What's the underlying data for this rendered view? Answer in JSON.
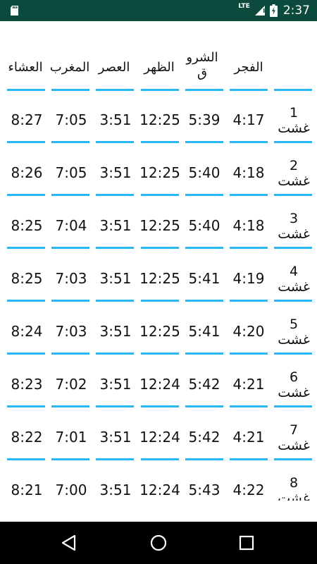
{
  "status_bar": {
    "network": "LTE",
    "time": "2:37",
    "icons": [
      "sd-card-icon",
      "signal-icon",
      "battery-charging-icon"
    ]
  },
  "table": {
    "headers": [
      "العشاء",
      "المغرب",
      "العصر",
      "الظهر",
      "الشروق",
      "الفجر",
      ""
    ],
    "rows": [
      {
        "day": "1",
        "month": "غشت",
        "isha": "8:27",
        "maghrib": "7:05",
        "asr": "3:51",
        "dhuhr": "12:25",
        "sunrise": "5:39",
        "fajr": "4:17"
      },
      {
        "day": "2",
        "month": "غشت",
        "isha": "8:26",
        "maghrib": "7:05",
        "asr": "3:51",
        "dhuhr": "12:25",
        "sunrise": "5:40",
        "fajr": "4:18"
      },
      {
        "day": "3",
        "month": "غشت",
        "isha": "8:25",
        "maghrib": "7:04",
        "asr": "3:51",
        "dhuhr": "12:25",
        "sunrise": "5:40",
        "fajr": "4:18"
      },
      {
        "day": "4",
        "month": "غشت",
        "isha": "8:25",
        "maghrib": "7:03",
        "asr": "3:51",
        "dhuhr": "12:25",
        "sunrise": "5:41",
        "fajr": "4:19"
      },
      {
        "day": "5",
        "month": "غشت",
        "isha": "8:24",
        "maghrib": "7:03",
        "asr": "3:51",
        "dhuhr": "12:25",
        "sunrise": "5:41",
        "fajr": "4:20"
      },
      {
        "day": "6",
        "month": "غشت",
        "isha": "8:23",
        "maghrib": "7:02",
        "asr": "3:51",
        "dhuhr": "12:24",
        "sunrise": "5:42",
        "fajr": "4:21"
      },
      {
        "day": "7",
        "month": "غشت",
        "isha": "8:22",
        "maghrib": "7:01",
        "asr": "3:51",
        "dhuhr": "12:24",
        "sunrise": "5:42",
        "fajr": "4:21"
      },
      {
        "day": "8",
        "month": "غشت",
        "isha": "8:21",
        "maghrib": "7:00",
        "asr": "3:51",
        "dhuhr": "12:24",
        "sunrise": "5:43",
        "fajr": "4:22"
      }
    ]
  },
  "nav_bar": {
    "buttons": [
      "back-icon",
      "home-icon",
      "recents-icon"
    ]
  },
  "colors": {
    "status_bar": "#0b4a3c",
    "underline": "#29b6f6",
    "nav_bar": "#000000"
  }
}
